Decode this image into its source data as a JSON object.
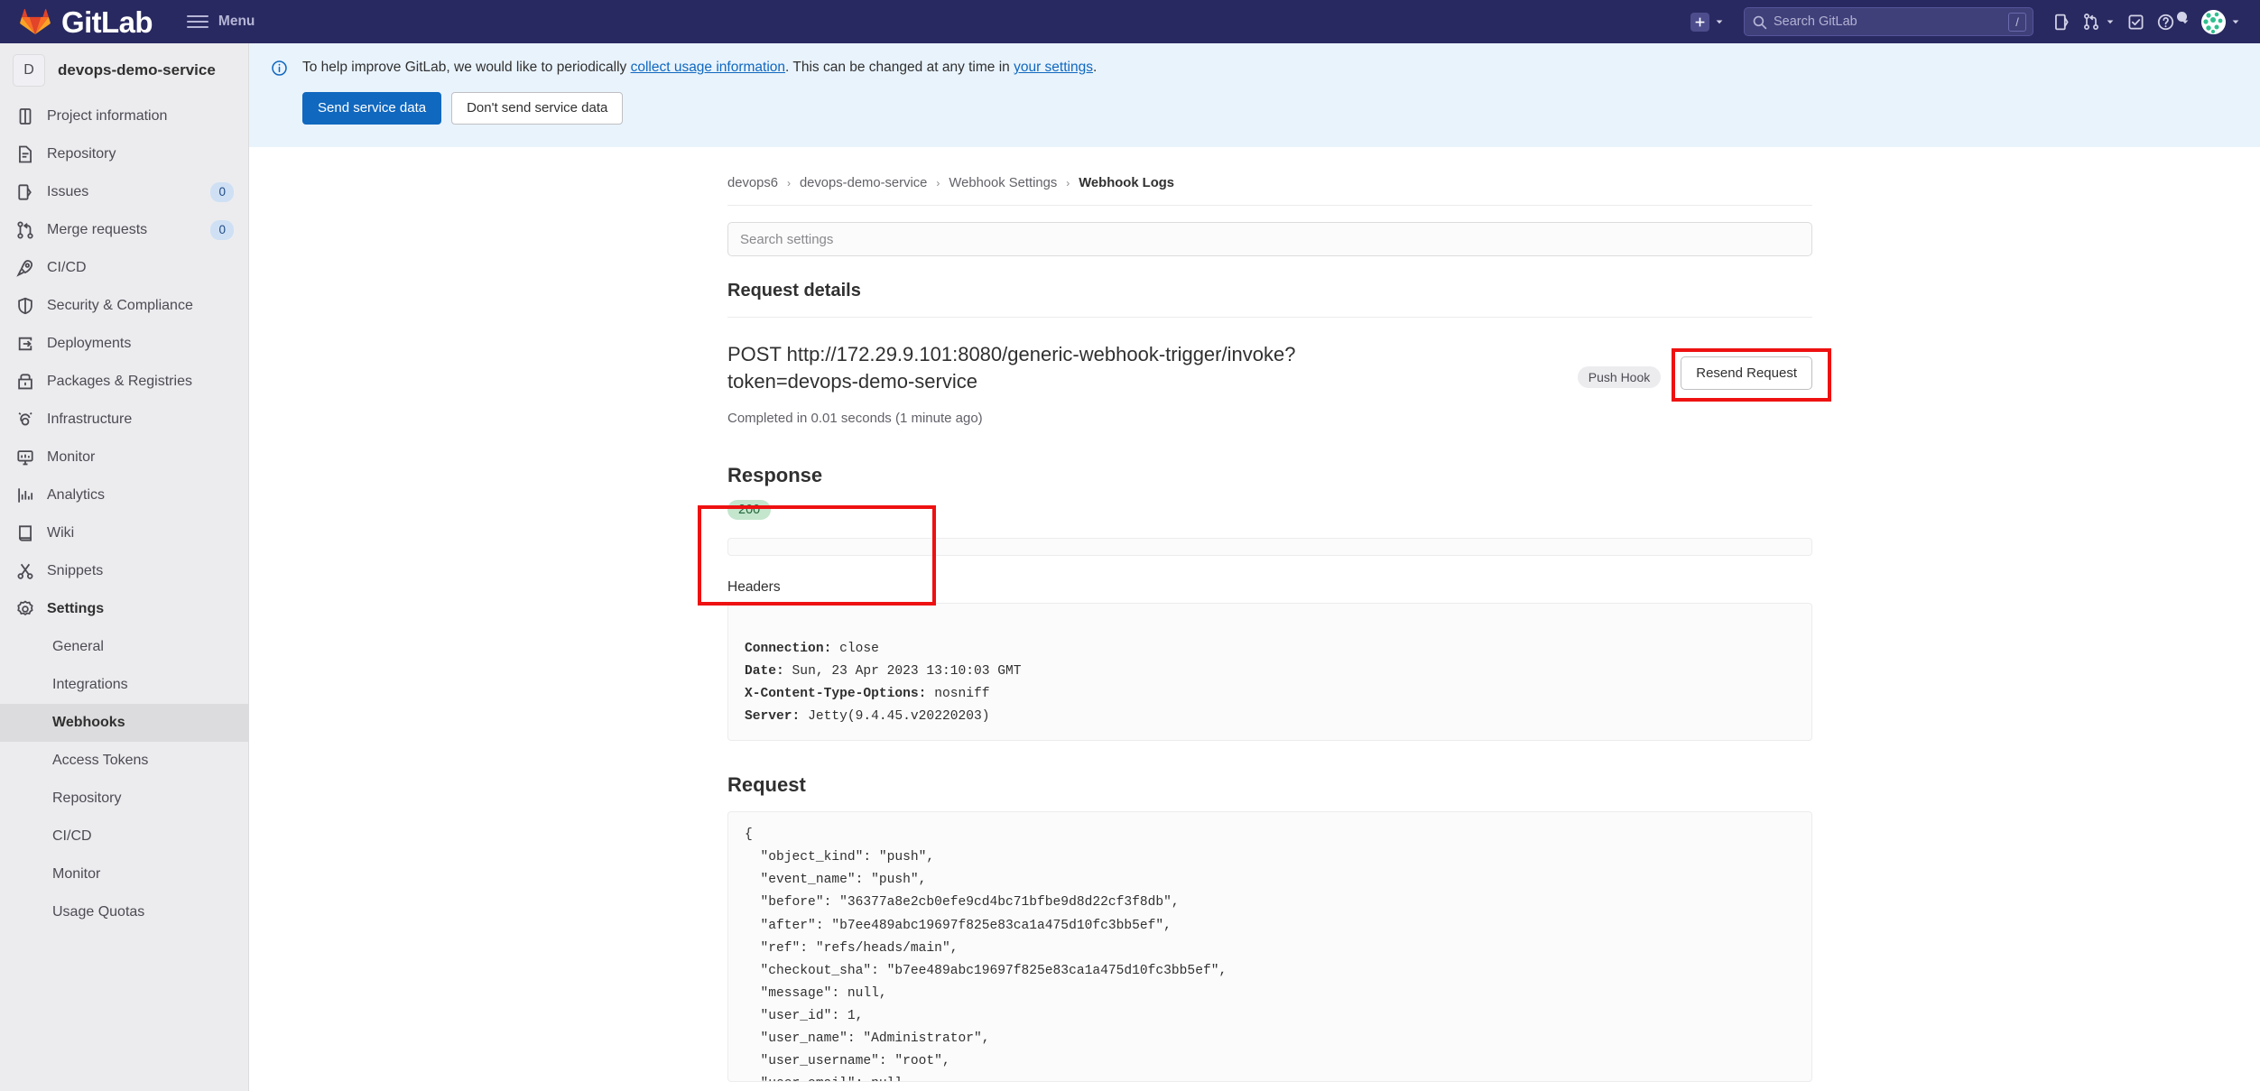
{
  "navbar": {
    "brand": "GitLab",
    "menu_label": "Menu",
    "search_placeholder": "Search GitLab",
    "search_value": "",
    "search_shortcut": "/",
    "icons": {
      "plus": "plus-icon",
      "plus_caret": "chevron-down-icon",
      "issues": "issues-icon",
      "merge_requests": "merge-request-icon",
      "mr_caret": "chevron-down-icon",
      "todos": "todo-checkbox-icon",
      "help": "help-question-icon",
      "help_caret": "chevron-down-icon",
      "avatar": "user-avatar",
      "avatar_caret": "chevron-down-icon"
    }
  },
  "sidebar": {
    "project": {
      "initial": "D",
      "name": "devops-demo-service"
    },
    "items": [
      {
        "label": "Project information",
        "icon": "project-info-icon",
        "badge": null
      },
      {
        "label": "Repository",
        "icon": "repository-icon",
        "badge": null
      },
      {
        "label": "Issues",
        "icon": "issues-icon",
        "badge": "0"
      },
      {
        "label": "Merge requests",
        "icon": "merge-request-icon",
        "badge": "0"
      },
      {
        "label": "CI/CD",
        "icon": "rocket-icon",
        "badge": null
      },
      {
        "label": "Security & Compliance",
        "icon": "shield-icon",
        "badge": null
      },
      {
        "label": "Deployments",
        "icon": "deployments-icon",
        "badge": null
      },
      {
        "label": "Packages & Registries",
        "icon": "package-icon",
        "badge": null
      },
      {
        "label": "Infrastructure",
        "icon": "infrastructure-icon",
        "badge": null
      },
      {
        "label": "Monitor",
        "icon": "monitor-icon",
        "badge": null
      },
      {
        "label": "Analytics",
        "icon": "analytics-icon",
        "badge": null
      },
      {
        "label": "Wiki",
        "icon": "wiki-book-icon",
        "badge": null
      },
      {
        "label": "Snippets",
        "icon": "snippet-scissors-icon",
        "badge": null
      },
      {
        "label": "Settings",
        "icon": "gear-icon",
        "badge": null,
        "active": true
      }
    ],
    "settings_subitems": [
      {
        "label": "General",
        "selected": false
      },
      {
        "label": "Integrations",
        "selected": false
      },
      {
        "label": "Webhooks",
        "selected": true
      },
      {
        "label": "Access Tokens",
        "selected": false
      },
      {
        "label": "Repository",
        "selected": false
      },
      {
        "label": "CI/CD",
        "selected": false
      },
      {
        "label": "Monitor",
        "selected": false
      },
      {
        "label": "Usage Quotas",
        "selected": false
      }
    ]
  },
  "banner": {
    "icon": "info-icon",
    "text_part1": "To help improve GitLab, we would like to periodically ",
    "link1": "collect usage information",
    "text_part2": ". This can be changed at any time in ",
    "link2": "your settings",
    "text_part3": ".",
    "primary_button": "Send service data",
    "secondary_button": "Don't send service data"
  },
  "breadcrumb": {
    "items": [
      "devops6",
      "devops-demo-service",
      "Webhook Settings"
    ],
    "current": "Webhook Logs",
    "separator": "›"
  },
  "search_settings": {
    "placeholder": "Search settings",
    "value": ""
  },
  "main": {
    "request_details_heading": "Request details",
    "post_url": "POST http://172.29.9.101:8080/generic-webhook-trigger/invoke?token=devops-demo-service",
    "completed_text": "Completed in 0.01 seconds (1 minute ago)",
    "hook_badge": "Push Hook",
    "resend_button": "Resend Request",
    "response_heading": "Response",
    "response_status": "200",
    "response_body": "",
    "headers_label": "Headers",
    "headers": [
      {
        "key": "Connection:",
        "value": " close"
      },
      {
        "key": "Date:",
        "value": " Sun, 23 Apr 2023 13:10:03 GMT"
      },
      {
        "key": "X-Content-Type-Options:",
        "value": " nosniff"
      },
      {
        "key": "Server:",
        "value": " Jetty(9.4.45.v20220203)"
      }
    ],
    "request_heading": "Request",
    "request_body": "{\n  \"object_kind\": \"push\",\n  \"event_name\": \"push\",\n  \"before\": \"36377a8e2cb0efe9cd4bc71bfbe9d8d22cf3f8db\",\n  \"after\": \"b7ee489abc19697f825e83ca1a475d10fc3bb5ef\",\n  \"ref\": \"refs/heads/main\",\n  \"checkout_sha\": \"b7ee489abc19697f825e83ca1a475d10fc3bb5ef\",\n  \"message\": null,\n  \"user_id\": 1,\n  \"user_name\": \"Administrator\",\n  \"user_username\": \"root\",\n  \"user_email\": null"
  },
  "colors": {
    "navbar_bg": "#292961",
    "brand_orange": "#fc6d26",
    "accent_blue": "#1068bf",
    "banner_bg": "#e9f3fc",
    "sidebar_bg": "#ececef",
    "status_success_bg": "#c3e6cd",
    "status_success_text": "#24663b",
    "annotation_red": "#ee1111"
  }
}
